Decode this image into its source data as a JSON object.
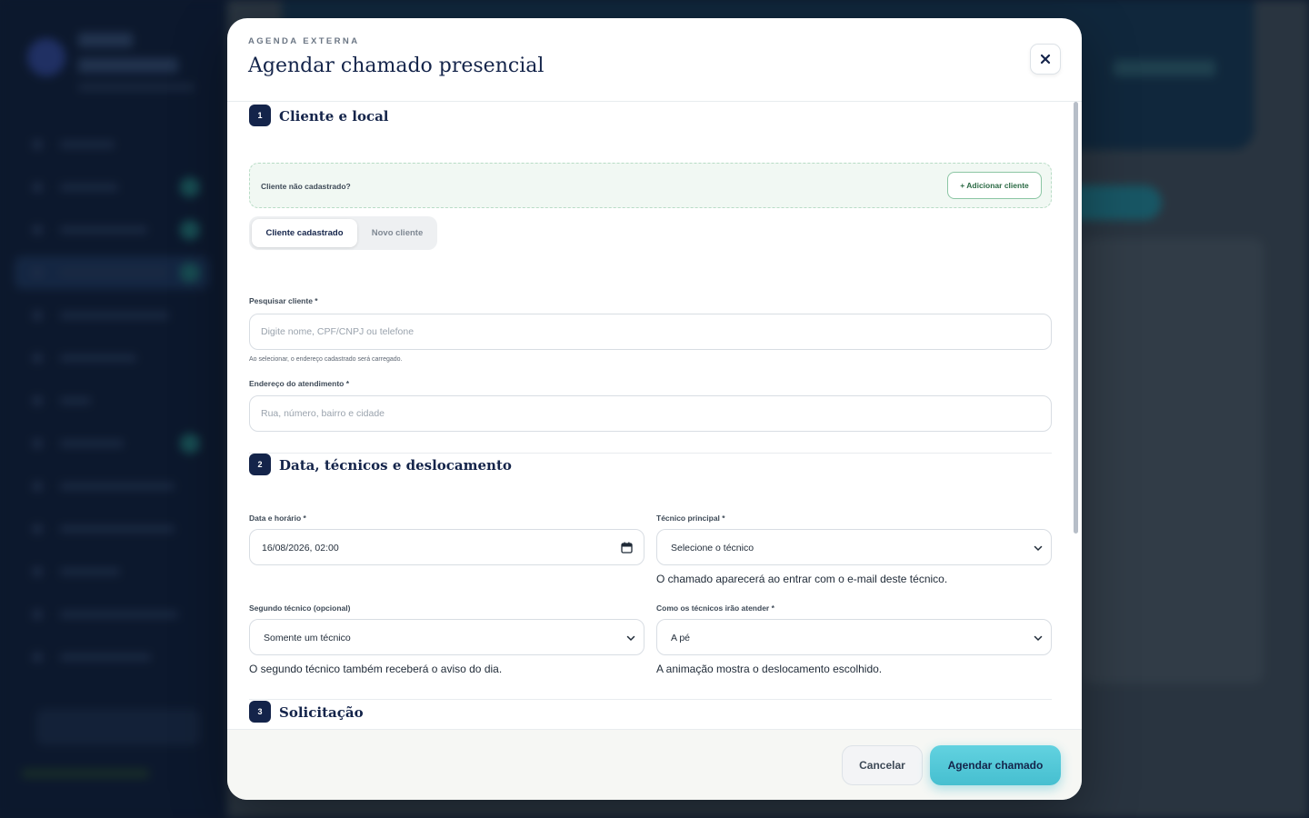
{
  "modal": {
    "eyebrow": "AGENDA EXTERNA",
    "title": "Agendar chamado presencial",
    "close_symbol": "✕"
  },
  "section1": {
    "step": "1",
    "title": "Cliente e local",
    "notice_text": "Cliente não cadastrado?",
    "add_client_label": "+ Adicionar cliente",
    "tabs": [
      {
        "label": "Cliente cadastrado",
        "active": true
      },
      {
        "label": "Novo cliente",
        "active": false
      }
    ],
    "search_label": "Pesquisar cliente *",
    "search_placeholder": "Digite nome, CPF/CNPJ ou telefone",
    "search_hint": "Ao selecionar, o endereço cadastrado será carregado.",
    "address_label": "Endereço do atendimento *",
    "address_placeholder": "Rua, número, bairro e cidade"
  },
  "section2": {
    "step": "2",
    "title": "Data, técnicos e deslocamento",
    "datetime_label": "Data e horário *",
    "datetime_value": "16/08/2026, 02:00",
    "main_tech_label": "Técnico principal *",
    "main_tech_value": "Selecione o técnico",
    "main_tech_hint": "O chamado aparecerá ao entrar com o e-mail deste técnico.",
    "second_tech_label": "Segundo técnico (opcional)",
    "second_tech_value": "Somente um técnico",
    "second_tech_hint": "O segundo técnico também receberá o aviso do dia.",
    "travel_label": "Como os técnicos irão atender *",
    "travel_value": "A pé",
    "travel_hint": "A animação mostra o deslocamento escolhido."
  },
  "section3": {
    "step": "3",
    "title": "Solicitação"
  },
  "footer": {
    "cancel_label": "Cancelar",
    "submit_label": "Agendar chamado"
  },
  "colors": {
    "primary_navy": "#14244a",
    "accent_cyan": "#46bfd0",
    "success_green": "#2b6a44"
  }
}
